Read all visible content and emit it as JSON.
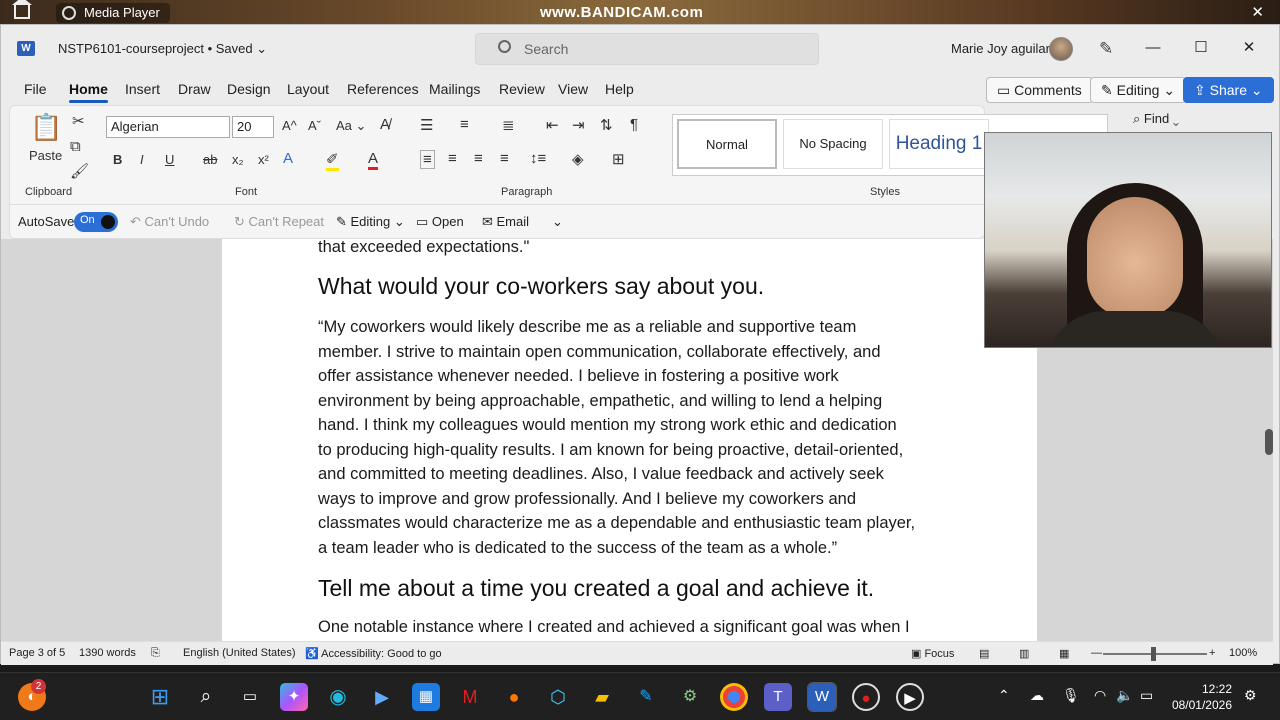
{
  "desktop": {
    "media_player_label": "Media Player",
    "watermark": "www.BANDICAM.com"
  },
  "titlebar": {
    "doc_title": "NSTP6101-courseproject • Saved",
    "search_placeholder": "Search",
    "user_name": "Marie Joy aguilar"
  },
  "menu": {
    "items": [
      "File",
      "Home",
      "Insert",
      "Draw",
      "Design",
      "Layout",
      "References",
      "Mailings",
      "Review",
      "View",
      "Help"
    ],
    "comments_label": "Comments",
    "editing_label": "Editing",
    "share_label": "Share"
  },
  "ribbon": {
    "paste_label": "Paste",
    "clipboard_label": "Clipboard",
    "font_name": "Algerian",
    "font_size": "20",
    "font_label": "Font",
    "paragraph_label": "Paragraph",
    "styles_label": "Styles",
    "style_normal": "Normal",
    "style_nospacing": "No Spacing",
    "style_heading1": "Heading 1",
    "find_label": "Find",
    "bold": "B",
    "italic": "I",
    "underline": "U",
    "strike": "ab",
    "subscript": "x₂",
    "superscript": "x²"
  },
  "qat": {
    "autosave_label": "AutoSave",
    "autosave_state": "On",
    "undo_label": "Can't Undo",
    "repeat_label": "Can't Repeat",
    "editing_label": "Editing",
    "open_label": "Open",
    "email_label": "Email"
  },
  "document": {
    "top_line": "that exceeded expectations.\"",
    "heading_coworkers": "What would your co-workers say about you.",
    "para_coworkers": [
      " “My coworkers would likely describe me as a reliable and supportive team",
      "member. I strive to maintain open communication, collaborate effectively, and",
      "offer assistance whenever needed. I believe in fostering a positive work",
      "environment by being approachable, empathetic, and willing to lend a helping",
      "hand. I think my colleagues would mention my strong work ethic and dedication",
      "to producing high-quality results. I am known for being proactive, detail-oriented,",
      "and committed to meeting deadlines. Also, I value feedback and actively seek",
      "ways to improve and grow professionally. And I believe my coworkers and",
      "classmates would characterize me as a dependable and enthusiastic team player,",
      "a team leader who is dedicated to the success of the team as a whole.”"
    ],
    "heading_goal": "Tell me about a time you created a goal and achieve it.",
    "para_goal_first": "One notable instance where I created and achieved a significant goal was when I"
  },
  "statusbar": {
    "page": "Page 3 of 5",
    "words": "1390 words",
    "language": "English (United States)",
    "accessibility": "Accessibility: Good to go",
    "focus": "Focus",
    "zoom": "100%"
  },
  "taskbar": {
    "badge_count": "2",
    "time": "12:22",
    "date": "08/01/2026"
  },
  "colors": {
    "accent": "#185abd",
    "share": "#2b6ed6",
    "heading1": "#2f5597"
  }
}
